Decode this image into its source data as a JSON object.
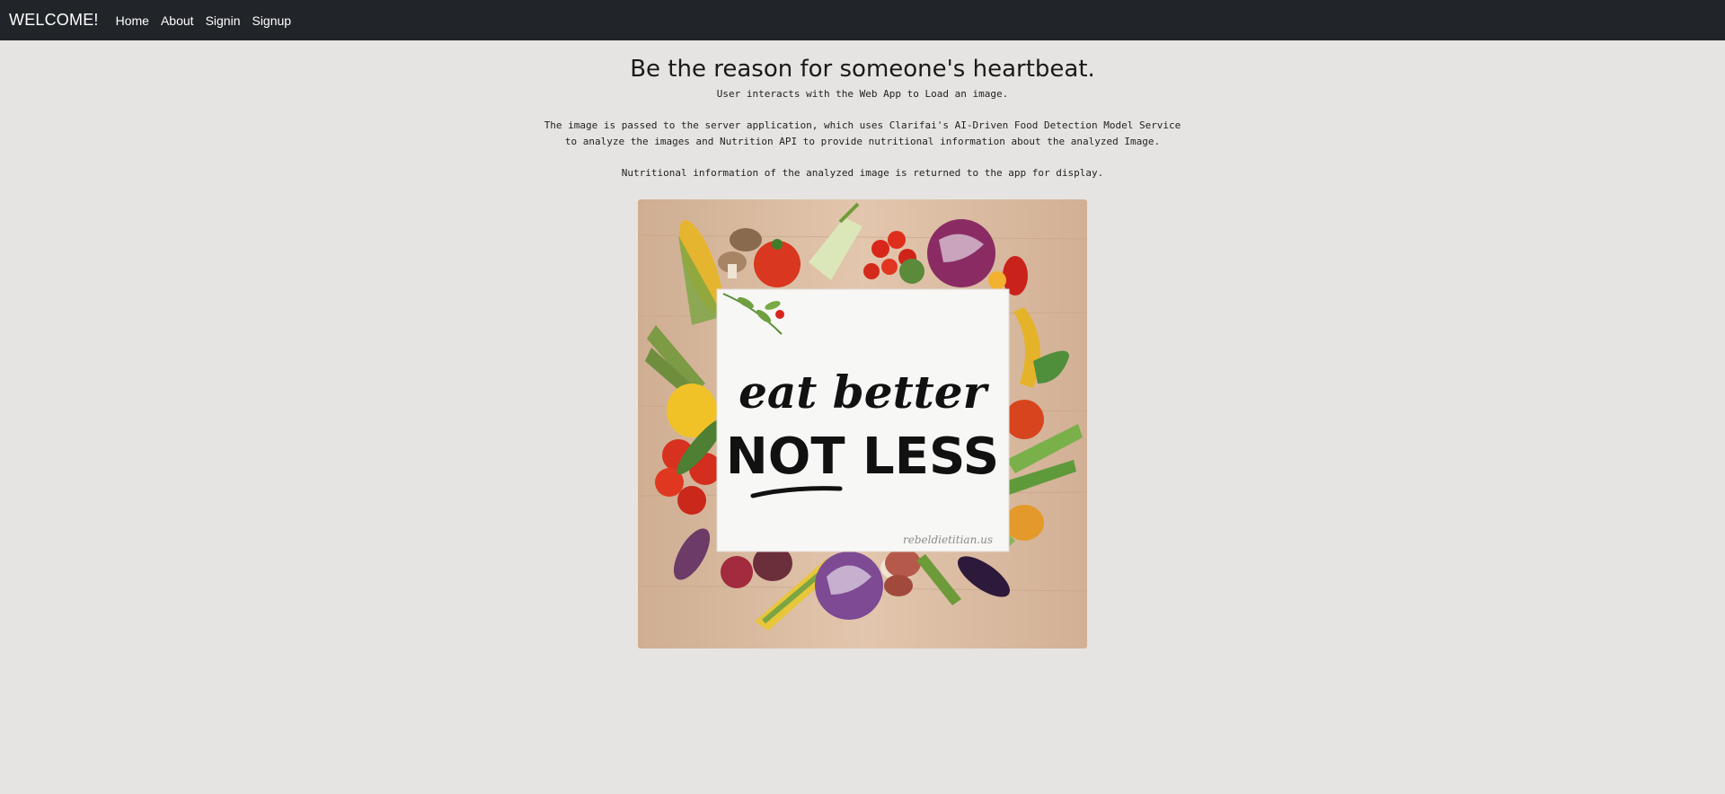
{
  "navbar": {
    "brand": "WELCOME!",
    "links": [
      "Home",
      "About",
      "Signin",
      "Signup"
    ]
  },
  "main": {
    "heading": "Be the reason for someone's heartbeat.",
    "paragraph1": "User interacts with the Web App to Load an image.",
    "paragraph2_line1": "The image is passed to the server application, which uses Clarifai's AI-Driven Food Detection Model Service",
    "paragraph2_line2": "to analyze the images and Nutrition API to provide nutritional information about the analyzed Image.",
    "paragraph3": "Nutritional information of the analyzed image is returned to the app for display."
  },
  "hero_image": {
    "line1": "eat better",
    "line2": "NOT LESS",
    "credit": "rebeldietitian.us"
  },
  "colors": {
    "navbar": "#212529",
    "page_background": "#e6e4e2",
    "wood": "#d9b99b"
  }
}
